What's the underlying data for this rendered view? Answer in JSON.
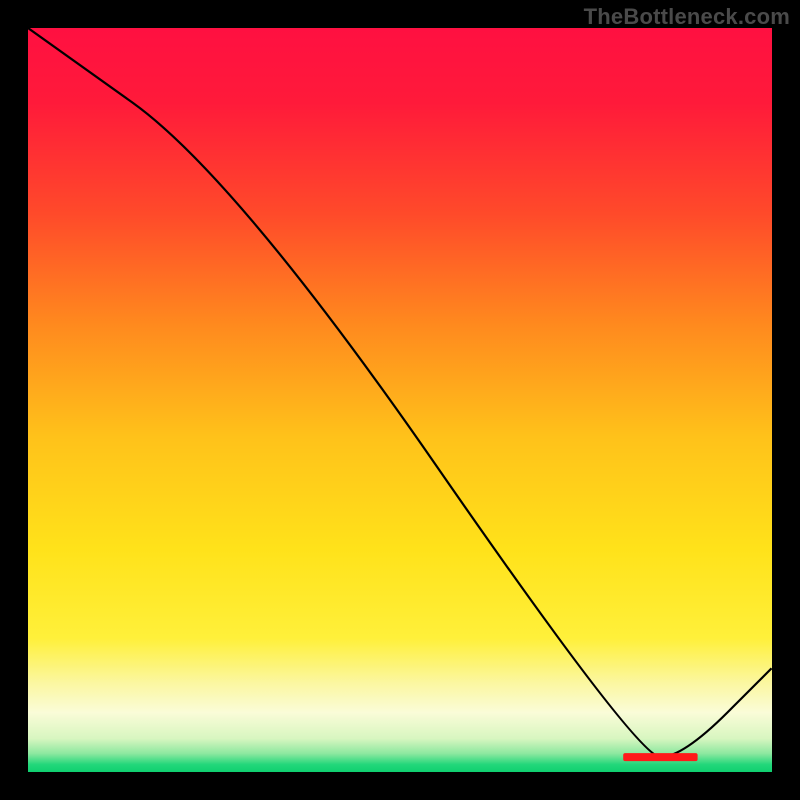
{
  "watermark": "TheBottleneck.com",
  "chart_data": {
    "type": "line",
    "title": "",
    "xlabel": "",
    "ylabel": "",
    "xlim": [
      0,
      100
    ],
    "ylim": [
      0,
      100
    ],
    "x": [
      0,
      28,
      82,
      88,
      100
    ],
    "values": [
      100,
      80,
      2,
      2,
      14
    ],
    "annotations": [
      {
        "text": "",
        "x": 85,
        "y": 3,
        "color": "#ff1a1a"
      }
    ],
    "gradient_stops": [
      {
        "offset": 0.0,
        "color": "#ff1041"
      },
      {
        "offset": 0.1,
        "color": "#ff1a3a"
      },
      {
        "offset": 0.25,
        "color": "#ff4a2a"
      },
      {
        "offset": 0.4,
        "color": "#ff8a1e"
      },
      {
        "offset": 0.55,
        "color": "#ffc21a"
      },
      {
        "offset": 0.7,
        "color": "#ffe21a"
      },
      {
        "offset": 0.82,
        "color": "#fff03a"
      },
      {
        "offset": 0.88,
        "color": "#fbf7a0"
      },
      {
        "offset": 0.92,
        "color": "#fafcd8"
      },
      {
        "offset": 0.955,
        "color": "#d8f6c0"
      },
      {
        "offset": 0.975,
        "color": "#8ee8a0"
      },
      {
        "offset": 0.99,
        "color": "#22d77a"
      },
      {
        "offset": 1.0,
        "color": "#0fcf70"
      }
    ]
  }
}
